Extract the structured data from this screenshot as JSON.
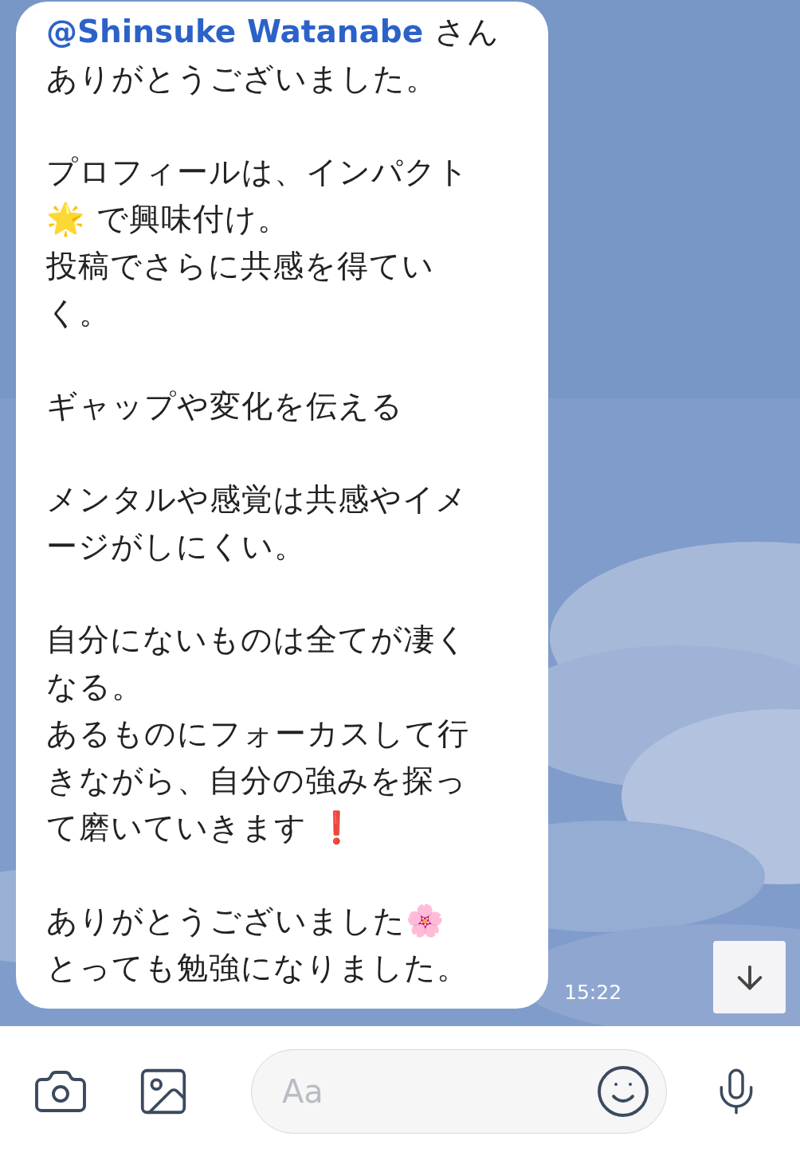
{
  "message": {
    "mention": "@Shinsuke Watanabe",
    "mention_suffix": "さん",
    "paragraphs": [
      [
        "ありがとうございました。"
      ],
      [
        "プロフィールは、インパクト",
        "🌟 で興味付け。",
        "投稿でさらに共感を得てい",
        "く。"
      ],
      [
        "ギャップや変化を伝える"
      ],
      [
        "メンタルや感覚は共感やイメ",
        "ージがしにくい。"
      ],
      [
        "自分にないものは全てが凄く",
        "なる。",
        "あるものにフォーカスして行",
        "きながら、自分の強みを探っ",
        "て磨いていきます ❗"
      ],
      [
        "ありがとうございました🌸",
        "とっても勉強になりました。"
      ]
    ],
    "time": "15:22"
  },
  "input": {
    "placeholder": "Aa"
  }
}
